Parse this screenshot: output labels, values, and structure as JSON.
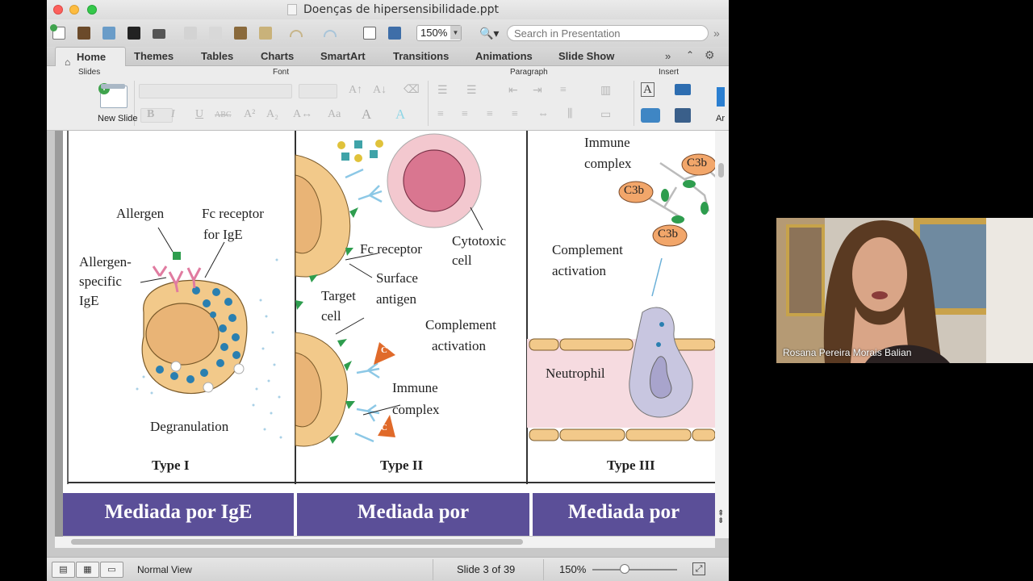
{
  "window": {
    "title": "Doenças de hipersensibilidade.ppt"
  },
  "toolbar": {
    "zoom": "150%",
    "search_placeholder": "Search in Presentation",
    "icons": [
      "new-icon",
      "templates-icon",
      "open-icon",
      "save-icon",
      "print-icon",
      "cut-icon",
      "copy-icon",
      "paste-icon",
      "format-painter-icon",
      "undo-icon",
      "redo-icon",
      "slide-icon",
      "media-icon"
    ]
  },
  "ribbon_tabs": [
    "Home",
    "Themes",
    "Tables",
    "Charts",
    "SmartArt",
    "Transitions",
    "Animations",
    "Slide Show"
  ],
  "ribbon_groups": {
    "slides": "Slides",
    "font": "Font",
    "paragraph": "Paragraph",
    "insert": "Insert"
  },
  "ribbon": {
    "new_slide": "New Slide",
    "bold": "B",
    "italic": "I",
    "underline": "U",
    "strike": "ABC",
    "superscript": "A²",
    "subscript": "A₂",
    "insert_text": "A",
    "insert_more": "Ar"
  },
  "slide": {
    "type1": {
      "title": "Type I",
      "labels": {
        "allergen": "Allergen",
        "fc_receptor": "Fc receptor",
        "for_ige": "for IgE",
        "allergen_specific_1": "Allergen-",
        "allergen_specific_2": "specific",
        "allergen_specific_3": "IgE",
        "degranulation": "Degranulation"
      }
    },
    "type2": {
      "title": "Type II",
      "labels": {
        "fc_receptor": "Fc receptor",
        "cytotoxic_1": "Cytotoxic",
        "cytotoxic_2": "cell",
        "surface_1": "Surface",
        "surface_2": "antigen",
        "target_1": "Target",
        "target_2": "cell",
        "complement_1": "Complement",
        "complement_2": "activation",
        "immune_1": "Immune",
        "immune_2": "complex",
        "c_label": "C"
      }
    },
    "type3": {
      "title": "Type III",
      "labels": {
        "immune_1": "Immune",
        "immune_2": "complex",
        "c3b": "C3b",
        "complement_1": "Complement",
        "complement_2": "activation",
        "neutrophil": "Neutrophil"
      }
    },
    "banners": [
      "Mediada por IgE",
      "Mediada por",
      "Mediada por"
    ]
  },
  "status": {
    "view": "Normal View",
    "slide_position": "Slide 3 of 39",
    "zoom": "150%"
  },
  "webcam": {
    "participant_name": "Rosana Pereira Morais Balian"
  },
  "colors": {
    "banner": "#5b4f98",
    "cell": "#f2c98a",
    "granule": "#2a7fb0",
    "antigen": "#2e9d4e",
    "complement": "#e06a2a",
    "cytotoxic": "#e39aa9",
    "vessel": "#f6dbe0"
  }
}
